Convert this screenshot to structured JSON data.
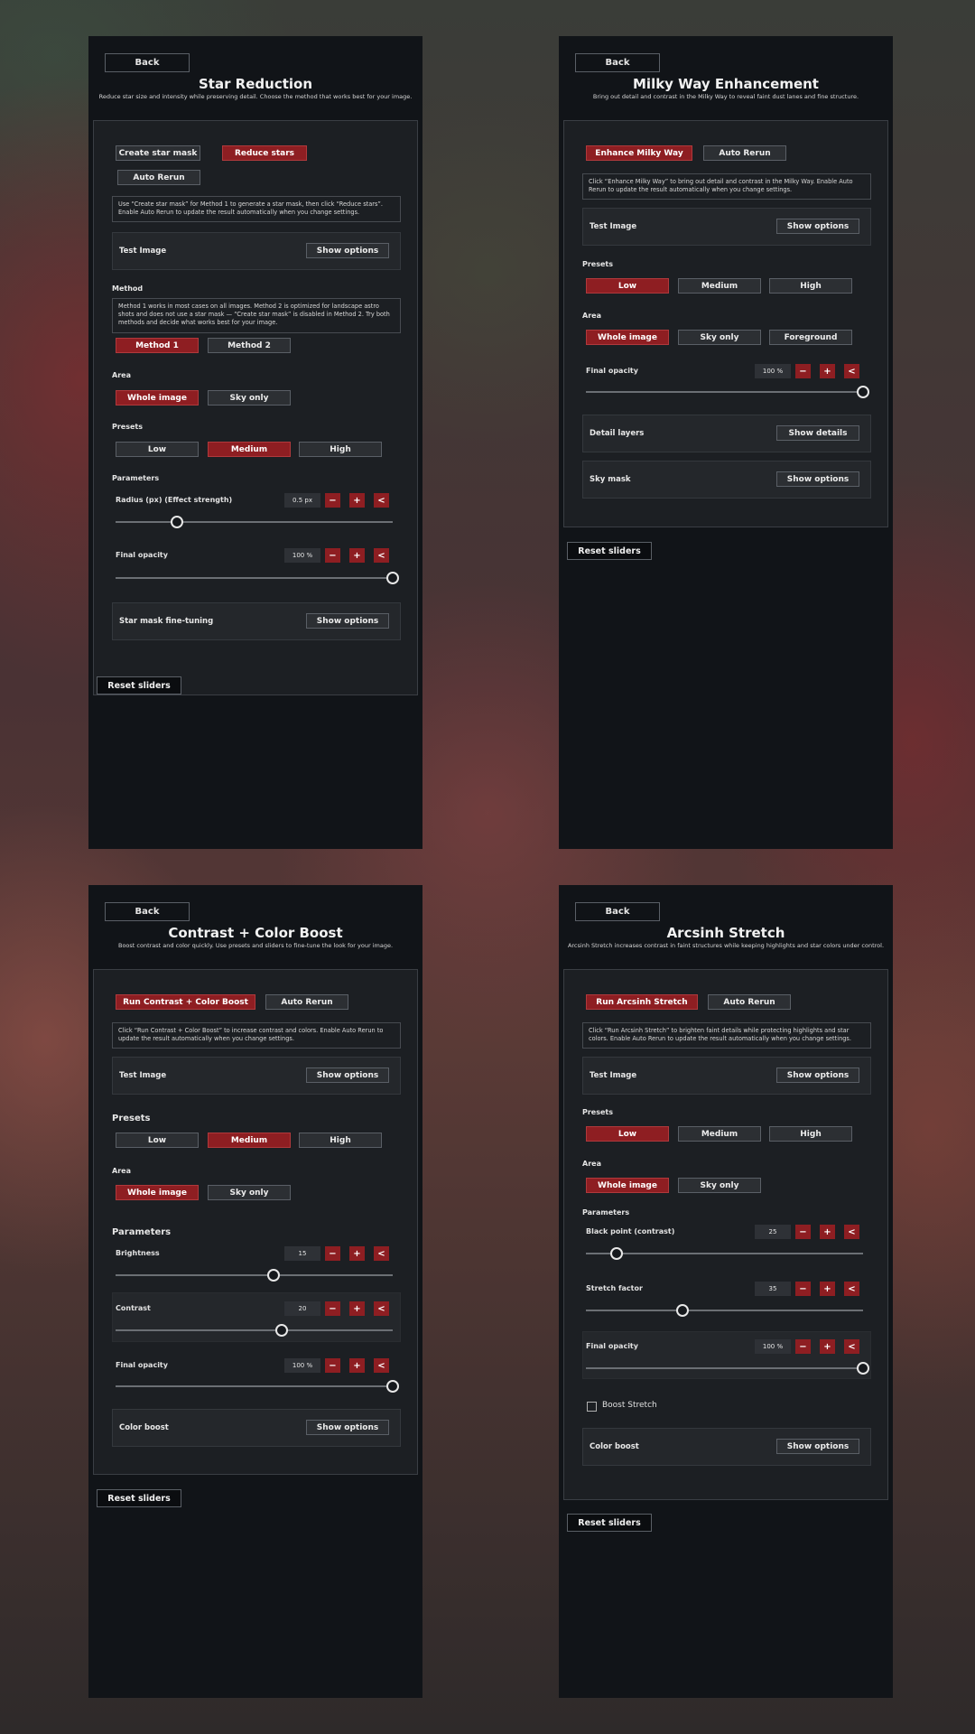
{
  "common": {
    "back": "Back",
    "reset": "Reset sliders",
    "show_options": "Show options",
    "show_details": "Show details",
    "minus": "−",
    "plus": "+",
    "reset_icon": "<",
    "test_image": "Test Image",
    "presets": "Presets",
    "area": "Area",
    "parameters": "Parameters",
    "low": "Low",
    "medium": "Medium",
    "high": "High",
    "whole_image": "Whole image",
    "sky_only": "Sky only",
    "auto_rerun": "Auto Rerun",
    "final_opacity": "Final opacity",
    "color_boost": "Color boost"
  },
  "star": {
    "title": "Star Reduction",
    "subtitle": "Reduce star size and intensity while preserving detail. Choose the method that works best for your image.",
    "create_mask": "Create star mask",
    "reduce_stars": "Reduce stars",
    "info": "Use “Create star mask” for Method 1 to generate a star mask, then click “Reduce stars”. Enable Auto Rerun to update the result automatically when you change settings.",
    "method_label": "Method",
    "method_info": "Method 1 works in most cases on all images. Method 2 is optimized for landscape astro shots and does not use a star mask — “Create star mask” is disabled in Method 2. Try both methods and decide what works best for your image.",
    "method1": "Method 1",
    "method2": "Method 2",
    "radius_label": "Radius (px) (Effect strength)",
    "radius_value": "0.5 px",
    "radius_level": 0.22,
    "opacity_value": "100 %",
    "opacity_level": 1.0,
    "fine_tuning": "Star mask fine-tuning"
  },
  "milky": {
    "title": "Milky Way Enhancement",
    "subtitle": "Bring out detail and contrast in the Milky Way to reveal faint dust lanes and fine structure.",
    "run": "Enhance Milky Way",
    "info": "Click “Enhance Milky Way” to bring out detail and contrast in the Milky Way. Enable Auto Rerun to update the result automatically when you change settings.",
    "foreground": "Foreground",
    "opacity_value": "100 %",
    "opacity_level": 1.0,
    "detail_layers": "Detail layers",
    "sky_mask": "Sky mask"
  },
  "contrast": {
    "title": "Contrast + Color Boost",
    "subtitle": "Boost contrast and color quickly. Use presets and sliders to fine-tune the look for your image.",
    "run": "Run Contrast + Color Boost",
    "info": "Click “Run Contrast + Color Boost” to increase contrast and colors. Enable Auto Rerun to update the result automatically when you change settings.",
    "brightness_label": "Brightness",
    "brightness_value": "15",
    "brightness_level": 0.57,
    "contrast_label": "Contrast",
    "contrast_value": "20",
    "contrast_level": 0.6,
    "opacity_value": "100 %",
    "opacity_level": 1.0
  },
  "arcsinh": {
    "title": "Arcsinh Stretch",
    "subtitle": "Arcsinh Stretch increases contrast in faint structures while keeping highlights and star colors under control.",
    "run": "Run Arcsinh Stretch",
    "info": "Click “Run Arcsinh Stretch” to brighten faint details while protecting highlights and star colors. Enable Auto Rerun to update the result automatically when you change settings.",
    "black_label": "Black point (contrast)",
    "black_value": "25",
    "black_level": 0.11,
    "stretch_label": "Stretch factor",
    "stretch_value": "35",
    "stretch_level": 0.35,
    "opacity_value": "100 %",
    "opacity_level": 1.0,
    "boost_stretch": "Boost Stretch"
  },
  "colors": {
    "accent": "#8e1e22",
    "panel": "#111418",
    "inner": "#1c1f23"
  }
}
